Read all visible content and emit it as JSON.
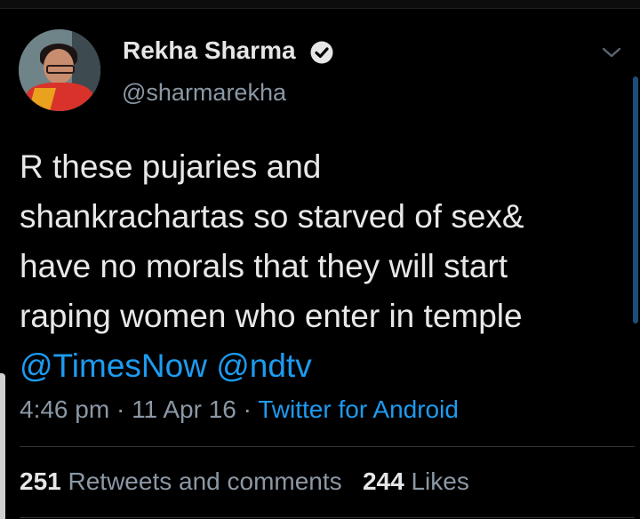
{
  "tweet": {
    "author_name": "Rekha Sharma",
    "author_handle": "@sharmarekha",
    "verified": true,
    "text_lines": [
      "R these pujaries and",
      "shankrachartas so starved of sex&",
      "have no morals that they will start",
      "raping women who enter in temple"
    ],
    "mentions": [
      "@TimesNow",
      "@ndtv"
    ],
    "time": "4:46 pm",
    "separator": "·",
    "date": "11 Apr 16",
    "source": "Twitter for Android",
    "retweets_count": "251",
    "retweets_label": "Retweets and comments",
    "likes_count": "244",
    "likes_label": "Likes"
  },
  "colors": {
    "background": "#000000",
    "text": "#e8e8e8",
    "secondary": "#8b98a5",
    "link": "#1d9bf0",
    "divider": "#2f3336"
  },
  "icons": {
    "verified": "verified-badge-icon",
    "menu": "chevron-down-icon"
  }
}
